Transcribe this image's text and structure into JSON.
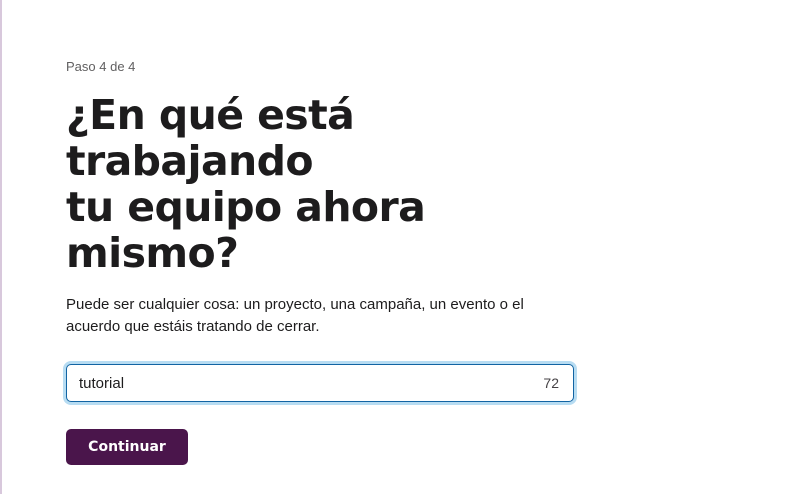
{
  "step": {
    "label": "Paso 4 de 4"
  },
  "heading": {
    "line1": "¿En qué está trabajando",
    "line2": "tu equipo ahora mismo?"
  },
  "description": "Puede ser cualquier cosa: un proyecto, una campaña, un evento o el acuerdo que estáis tratando de cerrar.",
  "project_input": {
    "value": "tutorial",
    "remaining_chars": "72"
  },
  "continue_button": {
    "label": "Continuar"
  },
  "colors": {
    "primary_button": "#4a154b",
    "focus_border": "#1264a3",
    "focus_ring": "#b7dcf2"
  }
}
